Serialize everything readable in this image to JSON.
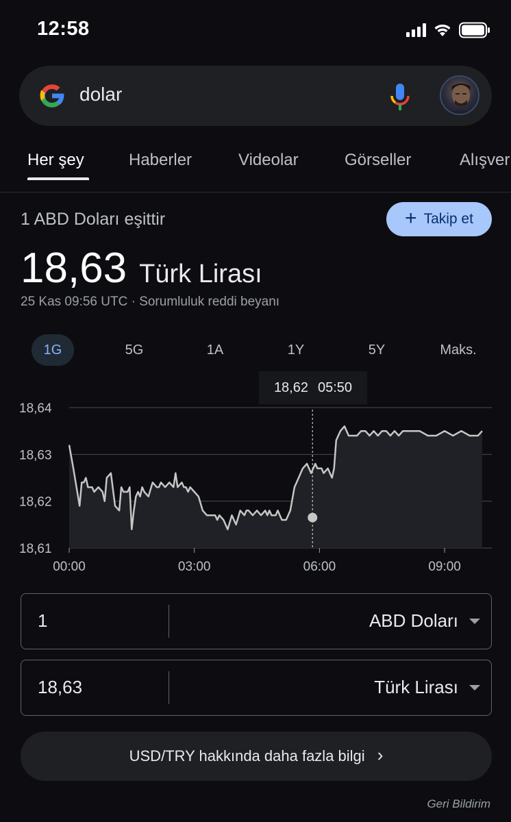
{
  "status_bar": {
    "time": "12:58"
  },
  "search": {
    "query": "dolar"
  },
  "tabs": [
    {
      "label": "Her şey",
      "active": true
    },
    {
      "label": "Haberler"
    },
    {
      "label": "Videolar"
    },
    {
      "label": "Görseller"
    },
    {
      "label": "Alışveriş"
    }
  ],
  "result": {
    "subtitle": "1 ABD Doları eşittir",
    "follow_label": "Takip et",
    "value": "18,63",
    "unit": "Türk Lirası",
    "meta": "25 Kas 09:56 UTC · Sorumluluk reddi beyanı"
  },
  "ranges": [
    "1G",
    "5G",
    "1A",
    "1Y",
    "5Y",
    "Maks."
  ],
  "active_range": "1G",
  "chart_data": {
    "type": "area",
    "x_ticks": [
      "00:00",
      "03:00",
      "06:00",
      "09:00"
    ],
    "y_ticks": [
      "18,64",
      "18,63",
      "18,62",
      "18,61"
    ],
    "ylim": [
      18.61,
      18.64
    ],
    "xlim_hours": [
      0,
      10
    ],
    "grid": true,
    "hover": {
      "value": "18,62",
      "time": "05:50",
      "hour": 5.833
    },
    "series": [
      {
        "x": [
          0.0,
          0.1,
          0.25,
          0.3,
          0.35,
          0.4,
          0.45,
          0.5,
          0.55,
          0.6,
          0.7,
          0.8,
          0.85,
          0.9,
          1.0,
          1.1,
          1.2,
          1.25,
          1.3,
          1.35,
          1.4,
          1.45,
          1.5,
          1.55,
          1.6,
          1.65,
          1.7,
          1.75,
          1.8,
          1.9,
          2.0,
          2.1,
          2.15,
          2.2,
          2.3,
          2.4,
          2.5,
          2.55,
          2.6,
          2.7,
          2.75,
          2.8,
          2.85,
          2.9,
          3.0,
          3.1,
          3.2,
          3.3,
          3.4,
          3.5,
          3.55,
          3.6,
          3.7,
          3.8,
          3.9,
          4.0,
          4.1,
          4.2,
          4.25,
          4.3,
          4.4,
          4.5,
          4.6,
          4.7,
          4.75,
          4.8,
          4.85,
          4.9,
          4.95,
          5.0,
          5.05,
          5.1,
          5.2,
          5.3,
          5.4,
          5.5,
          5.6,
          5.7,
          5.8,
          5.85,
          5.9,
          5.95,
          6.0,
          6.05,
          6.1,
          6.2,
          6.3,
          6.35,
          6.4,
          6.5,
          6.6,
          6.7,
          6.8,
          6.85,
          6.9,
          7.0,
          7.1,
          7.2,
          7.3,
          7.4,
          7.5,
          7.6,
          7.7,
          7.8,
          7.9,
          8.0,
          8.2,
          8.4,
          8.6,
          8.8,
          9.0,
          9.2,
          9.4,
          9.6,
          9.8,
          9.9
        ],
        "y": [
          18.632,
          18.627,
          18.619,
          18.624,
          18.624,
          18.625,
          18.623,
          18.623,
          18.623,
          18.622,
          18.623,
          18.622,
          18.62,
          18.625,
          18.626,
          18.619,
          18.618,
          18.623,
          18.622,
          18.622,
          18.622,
          18.623,
          18.614,
          18.618,
          18.621,
          18.622,
          18.621,
          18.623,
          18.622,
          18.621,
          18.624,
          18.623,
          18.623,
          18.624,
          18.623,
          18.624,
          18.623,
          18.626,
          18.623,
          18.624,
          18.623,
          18.623,
          18.622,
          18.623,
          18.622,
          18.621,
          18.618,
          18.617,
          18.617,
          18.617,
          18.616,
          18.617,
          18.616,
          18.614,
          18.617,
          18.615,
          18.618,
          18.617,
          18.618,
          18.618,
          18.617,
          18.618,
          18.617,
          18.618,
          18.617,
          18.618,
          18.617,
          18.617,
          18.617,
          18.618,
          18.617,
          18.616,
          18.616,
          18.618,
          18.623,
          18.625,
          18.627,
          18.628,
          18.626,
          18.627,
          18.628,
          18.627,
          18.627,
          18.627,
          18.626,
          18.627,
          18.625,
          18.627,
          18.633,
          18.635,
          18.636,
          18.634,
          18.634,
          18.634,
          18.634,
          18.635,
          18.635,
          18.634,
          18.635,
          18.634,
          18.635,
          18.635,
          18.634,
          18.635,
          18.634,
          18.635,
          18.635,
          18.635,
          18.634,
          18.634,
          18.635,
          18.634,
          18.635,
          18.634,
          18.634,
          18.635
        ]
      }
    ]
  },
  "converter": {
    "from": {
      "amount": "1",
      "unit": "ABD Doları"
    },
    "to": {
      "amount": "18,63",
      "unit": "Türk Lirası"
    }
  },
  "more_info": "USD/TRY hakkında daha fazla bilgi",
  "feedback": "Geri Bildirim"
}
